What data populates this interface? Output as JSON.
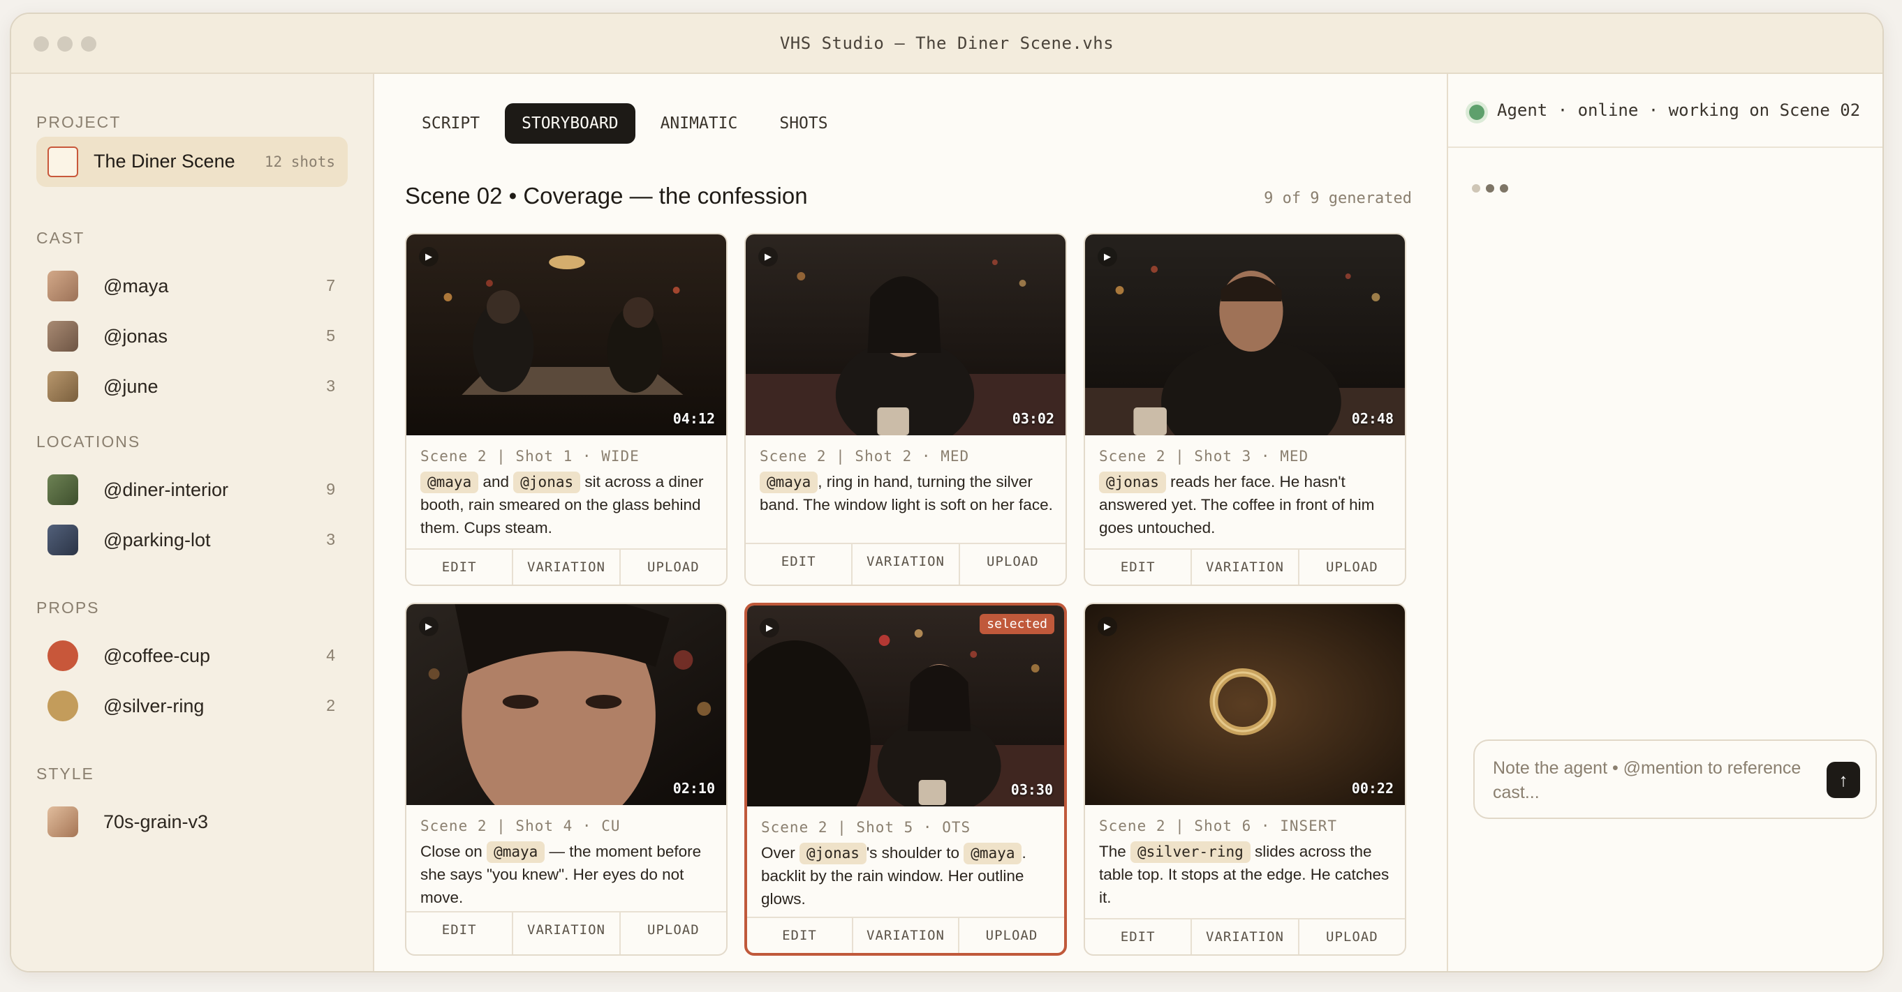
{
  "window": {
    "title": "VHS Studio — The Diner Scene.vhs"
  },
  "sidebar": {
    "project_heading": "PROJECT",
    "project": {
      "name": "The Diner Scene",
      "count": "12 shots"
    },
    "cast_heading": "CAST",
    "cast": [
      {
        "name": "@maya",
        "count": "7",
        "color": "#b78b6c"
      },
      {
        "name": "@jonas",
        "count": "5",
        "color": "#8a6e59"
      },
      {
        "name": "@june",
        "count": "3",
        "color": "#9a7b57"
      }
    ],
    "locations_heading": "LOCATIONS",
    "locations": [
      {
        "name": "@diner-interior",
        "count": "9",
        "color": "#55683f"
      },
      {
        "name": "@parking-lot",
        "count": "3",
        "color": "#3e4a5f"
      }
    ],
    "props_heading": "PROPS",
    "props": [
      {
        "name": "@coffee-cup",
        "count": "4",
        "color": "#c8573a"
      },
      {
        "name": "@silver-ring",
        "count": "2",
        "color": "#c39c5b"
      }
    ],
    "style_heading": "STYLE",
    "style": [
      {
        "name": "70s-grain-v3",
        "color": "#c59a78"
      }
    ]
  },
  "main": {
    "tabs": [
      "SCRIPT",
      "STORYBOARD",
      "ANIMATIC",
      "SHOTS"
    ],
    "active_tab": "STORYBOARD",
    "scene_title": "Scene 02 • Coverage — the confession",
    "scene_count": "9 of 9 generated",
    "selected_badge": "selected",
    "actions": [
      "EDIT",
      "VARIATION",
      "UPLOAD"
    ],
    "shots": [
      {
        "meta": "Scene 2 | Shot 1 · WIDE",
        "duration": "04:12",
        "t0": "@maya",
        "t1": " and ",
        "t2": "@jonas",
        "t3": " sit across a diner booth, rain smeared on the glass behind them. Cups steam."
      },
      {
        "meta": "Scene 2 | Shot 2 · MED",
        "duration": "03:02",
        "t0": "@maya",
        "t1": ", ring in hand, turning the silver band. The window light is soft on her face."
      },
      {
        "meta": "Scene 2 | Shot 3 · MED",
        "duration": "02:48",
        "t0": "@jonas",
        "t1": " reads her face. He hasn't answered yet. The coffee in front of him goes untouched."
      },
      {
        "meta": "Scene 2 | Shot 4 · CU",
        "duration": "02:10",
        "t0": "Close on ",
        "t1": "@maya",
        "t2": " — the moment before she says \"you knew\". Her eyes do not move."
      },
      {
        "meta": "Scene 2 | Shot 5 · OTS",
        "duration": "03:30",
        "t0": "Over ",
        "t1": "@jonas",
        "t2": "'s shoulder to ",
        "t3": "@maya",
        "t4": ". backlit by the rain window. Her outline glows."
      },
      {
        "meta": "Scene 2 | Shot 6 · INSERT",
        "duration": "00:22",
        "t0": "The ",
        "t1": "@silver-ring",
        "t2": " slides across the table top. It stops at the edge. He catches it."
      }
    ]
  },
  "agent": {
    "status": "Agent · online · working on Scene 02",
    "status_color": "#5ea06c",
    "composer_placeholder": "Note the agent • @mention to reference cast..."
  }
}
